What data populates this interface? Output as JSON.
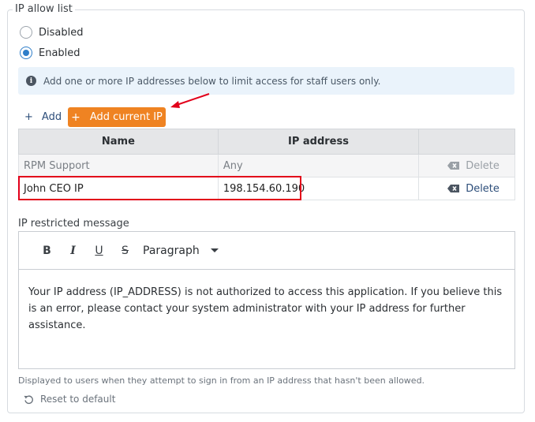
{
  "section": {
    "legend": "IP allow list"
  },
  "access": {
    "options": [
      {
        "label": "Disabled",
        "checked": false
      },
      {
        "label": "Enabled",
        "checked": true
      }
    ]
  },
  "info": {
    "icon": "info-icon",
    "text": "Add one or more IP addresses below to limit access for staff users only."
  },
  "actions": {
    "add_label": "Add",
    "add_current_ip_label": "Add current IP",
    "accent_color": "#ef8322"
  },
  "table": {
    "headers": [
      "Name",
      "IP address",
      ""
    ],
    "rows": [
      {
        "name": "RPM Support",
        "ip": "Any",
        "delete_label": "Delete"
      },
      {
        "name": "John CEO IP",
        "ip": "198.154.60.190",
        "delete_label": "Delete"
      }
    ]
  },
  "message": {
    "label": "IP restricted message",
    "toolbar": {
      "bold": "B",
      "italic": "I",
      "underline": "U",
      "strike": "S",
      "block_format": "Paragraph"
    },
    "body": "Your IP address (IP_ADDRESS) is not authorized to access this application. If you believe this is an error, please contact your system administrator with your IP address for further assistance.",
    "helper": "Displayed to users when they attempt to sign in from an IP address that hasn't been allowed.",
    "reset_label": "Reset to default"
  },
  "annotation_color": "#e2001a"
}
